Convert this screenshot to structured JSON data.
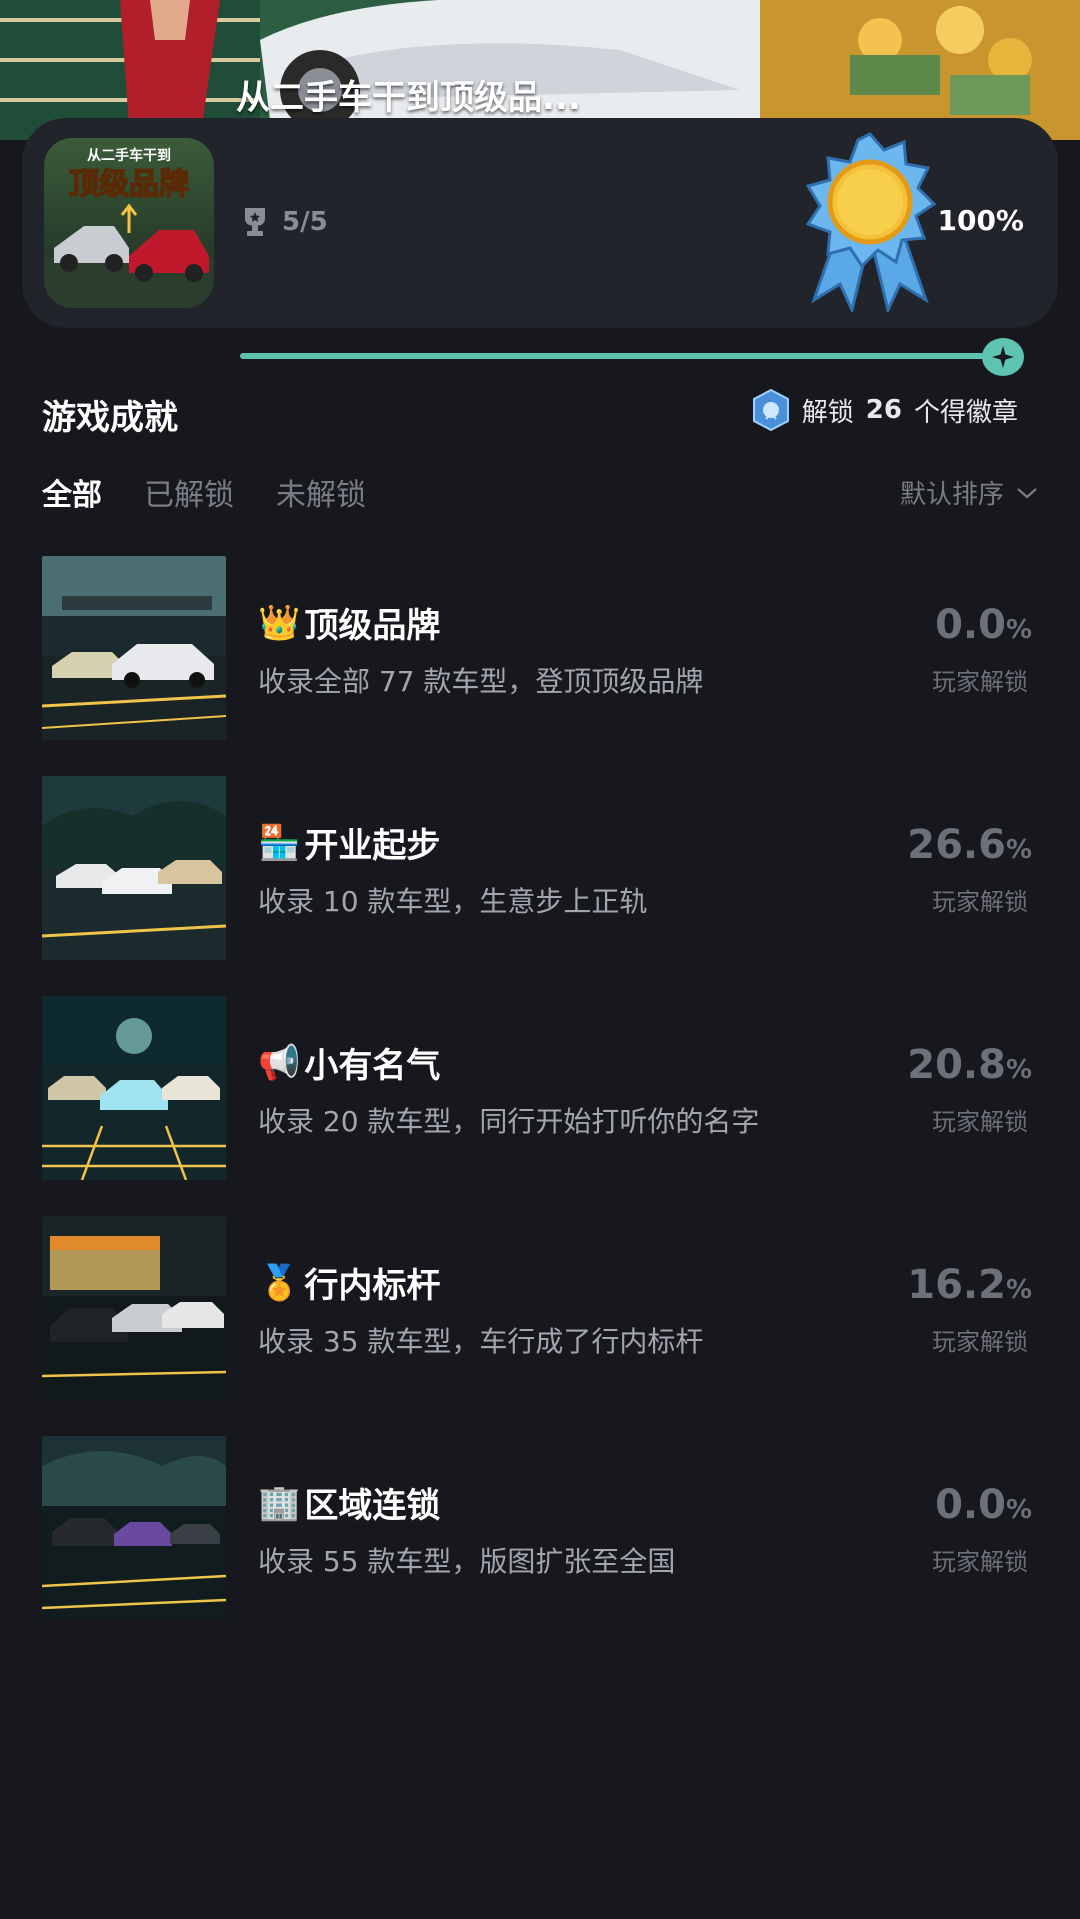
{
  "banner": {
    "title": "从二手车干到顶级品..."
  },
  "game": {
    "cover_title_small": "从二手车干到",
    "cover_title_big": "顶级品牌",
    "progress_text": "5/5",
    "percent": "100%",
    "progress_fraction": 1.0
  },
  "section": {
    "title": "游戏成就",
    "badge_prefix": "解锁",
    "badge_count": "26",
    "badge_suffix": "个得徽章"
  },
  "tabs": [
    "全部",
    "已解锁",
    "未解锁"
  ],
  "sort": {
    "label": "默认排序"
  },
  "rate_label": "玩家解锁",
  "rate_unit": "%",
  "achievements": [
    {
      "emoji": "👑",
      "title": "顶级品牌",
      "desc": "收录全部 77 款车型，登顶顶级品牌",
      "rate": "0.0"
    },
    {
      "emoji": "🏪",
      "title": "开业起步",
      "desc": "收录 10 款车型，生意步上正轨",
      "rate": "26.6"
    },
    {
      "emoji": "📢",
      "title": "小有名气",
      "desc": "收录 20 款车型，同行开始打听你的名字",
      "rate": "20.8"
    },
    {
      "emoji": "🏅",
      "title": "行内标杆",
      "desc": "收录 35 款车型，车行成了行内标杆",
      "rate": "16.2"
    },
    {
      "emoji": "🏢",
      "title": "区域连锁",
      "desc": "收录 55 款车型，版图扩张至全国",
      "rate": "0.0"
    }
  ]
}
